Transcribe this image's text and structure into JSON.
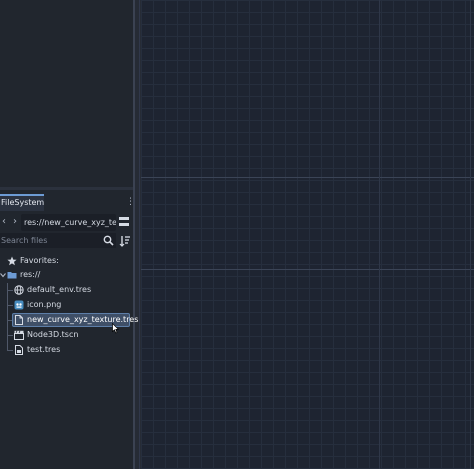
{
  "filesystem_dock": {
    "tab_label": "FileSystem",
    "menu_icon": "kebab-menu-icon",
    "nav": {
      "back_icon": "chevron-left-icon",
      "forward_icon": "chevron-right-icon"
    },
    "path_value": "res://new_curve_xyz_te",
    "search": {
      "placeholder": "Search files",
      "icon": "search-icon"
    },
    "sort_icon": "sort-icon",
    "tree": {
      "favorites_label": "Favorites:",
      "root_label": "res://",
      "items": [
        {
          "label": "default_env.tres",
          "icon": "globe-environment-icon",
          "selected": false
        },
        {
          "label": "icon.png",
          "icon": "image-icon",
          "selected": false
        },
        {
          "label": "new_curve_xyz_texture.tres",
          "icon": "resource-file-icon",
          "selected": true
        },
        {
          "label": "Node3D.tscn",
          "icon": "scene-clapperboard-icon",
          "selected": false
        },
        {
          "label": "test.tres",
          "icon": "resource-file-icon",
          "selected": false
        }
      ]
    }
  },
  "colors": {
    "dock_background": "#21262e",
    "viewport_background": "#1e2431",
    "tab_accent": "#6d9bd4",
    "selection": "#3f4f67",
    "folder": "#6d9bd4"
  }
}
